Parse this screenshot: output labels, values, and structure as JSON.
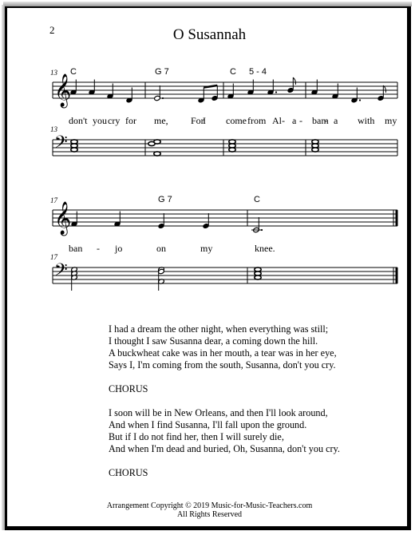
{
  "page": {
    "number": "2",
    "title": "O Susannah"
  },
  "system1": {
    "measure_number_treble": "13",
    "measure_number_bass": "13",
    "chords": [
      "C",
      "G 7",
      "C",
      "5 - 4"
    ],
    "lyrics": [
      "don't",
      "you",
      "cry",
      "for",
      "me,",
      "For",
      "I",
      "come",
      "from",
      "Al",
      "-",
      "a",
      "-",
      "bam",
      "-",
      "a",
      "with",
      "my"
    ]
  },
  "system2": {
    "measure_number_treble": "17",
    "measure_number_bass": "17",
    "chords": [
      "G 7",
      "C"
    ],
    "lyrics": [
      "ban",
      "-",
      "jo",
      "on",
      "my",
      "knee."
    ]
  },
  "verses": [
    {
      "lines": [
        "I had a dream the other night, when everything was still;",
        "I thought I saw Susanna dear, a coming down the hill.",
        "A buckwheat cake was in her mouth, a tear was in her eye,",
        "Says I, I'm coming from the south, Susanna, don't you cry."
      ]
    },
    {
      "lines": [
        "CHORUS"
      ]
    },
    {
      "lines": [
        "I soon will be in New Orleans, and then I'll look around,",
        "And when I find Susanna, I'll fall upon the ground.",
        "But if I do not find her, then I will surely die,",
        "And when I'm dead and buried, Oh, Susanna, don't you cry."
      ]
    },
    {
      "lines": [
        "CHORUS"
      ]
    }
  ],
  "footer": {
    "copyright": "Arrangement Copyright © 2019 Music-for-Music-Teachers.com",
    "rights": "All Rights Reserved"
  }
}
